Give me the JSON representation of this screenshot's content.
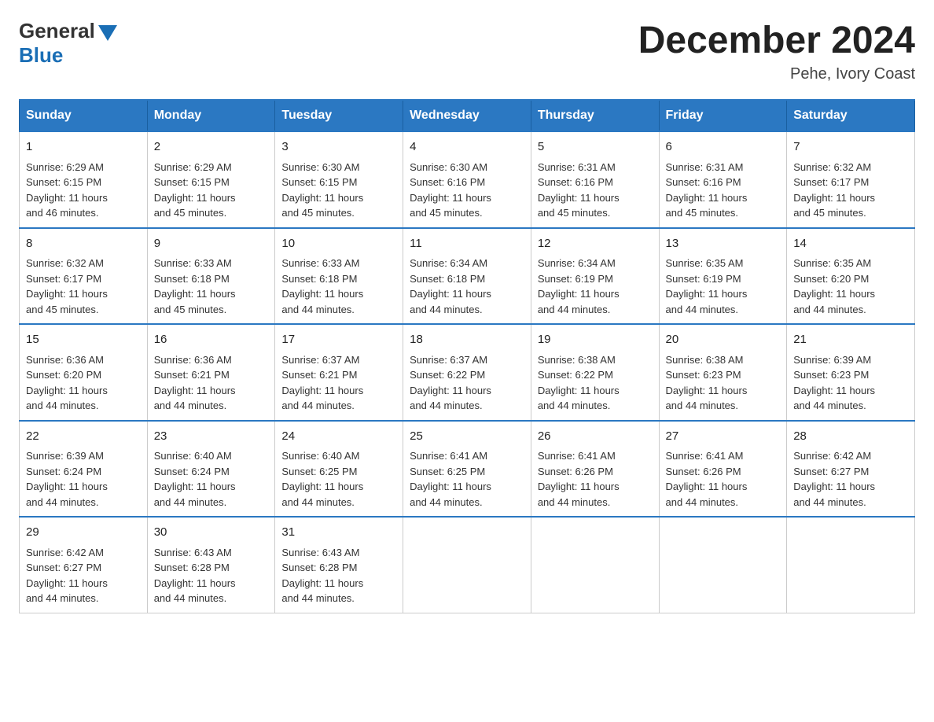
{
  "logo": {
    "general": "General",
    "blue": "Blue",
    "arrow_color": "#1a6eb5"
  },
  "header": {
    "title": "December 2024",
    "subtitle": "Pehe, Ivory Coast"
  },
  "weekdays": [
    "Sunday",
    "Monday",
    "Tuesday",
    "Wednesday",
    "Thursday",
    "Friday",
    "Saturday"
  ],
  "weeks": [
    [
      {
        "day": "1",
        "sunrise": "6:29 AM",
        "sunset": "6:15 PM",
        "daylight": "11 hours and 46 minutes."
      },
      {
        "day": "2",
        "sunrise": "6:29 AM",
        "sunset": "6:15 PM",
        "daylight": "11 hours and 45 minutes."
      },
      {
        "day": "3",
        "sunrise": "6:30 AM",
        "sunset": "6:15 PM",
        "daylight": "11 hours and 45 minutes."
      },
      {
        "day": "4",
        "sunrise": "6:30 AM",
        "sunset": "6:16 PM",
        "daylight": "11 hours and 45 minutes."
      },
      {
        "day": "5",
        "sunrise": "6:31 AM",
        "sunset": "6:16 PM",
        "daylight": "11 hours and 45 minutes."
      },
      {
        "day": "6",
        "sunrise": "6:31 AM",
        "sunset": "6:16 PM",
        "daylight": "11 hours and 45 minutes."
      },
      {
        "day": "7",
        "sunrise": "6:32 AM",
        "sunset": "6:17 PM",
        "daylight": "11 hours and 45 minutes."
      }
    ],
    [
      {
        "day": "8",
        "sunrise": "6:32 AM",
        "sunset": "6:17 PM",
        "daylight": "11 hours and 45 minutes."
      },
      {
        "day": "9",
        "sunrise": "6:33 AM",
        "sunset": "6:18 PM",
        "daylight": "11 hours and 45 minutes."
      },
      {
        "day": "10",
        "sunrise": "6:33 AM",
        "sunset": "6:18 PM",
        "daylight": "11 hours and 44 minutes."
      },
      {
        "day": "11",
        "sunrise": "6:34 AM",
        "sunset": "6:18 PM",
        "daylight": "11 hours and 44 minutes."
      },
      {
        "day": "12",
        "sunrise": "6:34 AM",
        "sunset": "6:19 PM",
        "daylight": "11 hours and 44 minutes."
      },
      {
        "day": "13",
        "sunrise": "6:35 AM",
        "sunset": "6:19 PM",
        "daylight": "11 hours and 44 minutes."
      },
      {
        "day": "14",
        "sunrise": "6:35 AM",
        "sunset": "6:20 PM",
        "daylight": "11 hours and 44 minutes."
      }
    ],
    [
      {
        "day": "15",
        "sunrise": "6:36 AM",
        "sunset": "6:20 PM",
        "daylight": "11 hours and 44 minutes."
      },
      {
        "day": "16",
        "sunrise": "6:36 AM",
        "sunset": "6:21 PM",
        "daylight": "11 hours and 44 minutes."
      },
      {
        "day": "17",
        "sunrise": "6:37 AM",
        "sunset": "6:21 PM",
        "daylight": "11 hours and 44 minutes."
      },
      {
        "day": "18",
        "sunrise": "6:37 AM",
        "sunset": "6:22 PM",
        "daylight": "11 hours and 44 minutes."
      },
      {
        "day": "19",
        "sunrise": "6:38 AM",
        "sunset": "6:22 PM",
        "daylight": "11 hours and 44 minutes."
      },
      {
        "day": "20",
        "sunrise": "6:38 AM",
        "sunset": "6:23 PM",
        "daylight": "11 hours and 44 minutes."
      },
      {
        "day": "21",
        "sunrise": "6:39 AM",
        "sunset": "6:23 PM",
        "daylight": "11 hours and 44 minutes."
      }
    ],
    [
      {
        "day": "22",
        "sunrise": "6:39 AM",
        "sunset": "6:24 PM",
        "daylight": "11 hours and 44 minutes."
      },
      {
        "day": "23",
        "sunrise": "6:40 AM",
        "sunset": "6:24 PM",
        "daylight": "11 hours and 44 minutes."
      },
      {
        "day": "24",
        "sunrise": "6:40 AM",
        "sunset": "6:25 PM",
        "daylight": "11 hours and 44 minutes."
      },
      {
        "day": "25",
        "sunrise": "6:41 AM",
        "sunset": "6:25 PM",
        "daylight": "11 hours and 44 minutes."
      },
      {
        "day": "26",
        "sunrise": "6:41 AM",
        "sunset": "6:26 PM",
        "daylight": "11 hours and 44 minutes."
      },
      {
        "day": "27",
        "sunrise": "6:41 AM",
        "sunset": "6:26 PM",
        "daylight": "11 hours and 44 minutes."
      },
      {
        "day": "28",
        "sunrise": "6:42 AM",
        "sunset": "6:27 PM",
        "daylight": "11 hours and 44 minutes."
      }
    ],
    [
      {
        "day": "29",
        "sunrise": "6:42 AM",
        "sunset": "6:27 PM",
        "daylight": "11 hours and 44 minutes."
      },
      {
        "day": "30",
        "sunrise": "6:43 AM",
        "sunset": "6:28 PM",
        "daylight": "11 hours and 44 minutes."
      },
      {
        "day": "31",
        "sunrise": "6:43 AM",
        "sunset": "6:28 PM",
        "daylight": "11 hours and 44 minutes."
      },
      null,
      null,
      null,
      null
    ]
  ],
  "labels": {
    "sunrise": "Sunrise:",
    "sunset": "Sunset:",
    "daylight": "Daylight:"
  }
}
